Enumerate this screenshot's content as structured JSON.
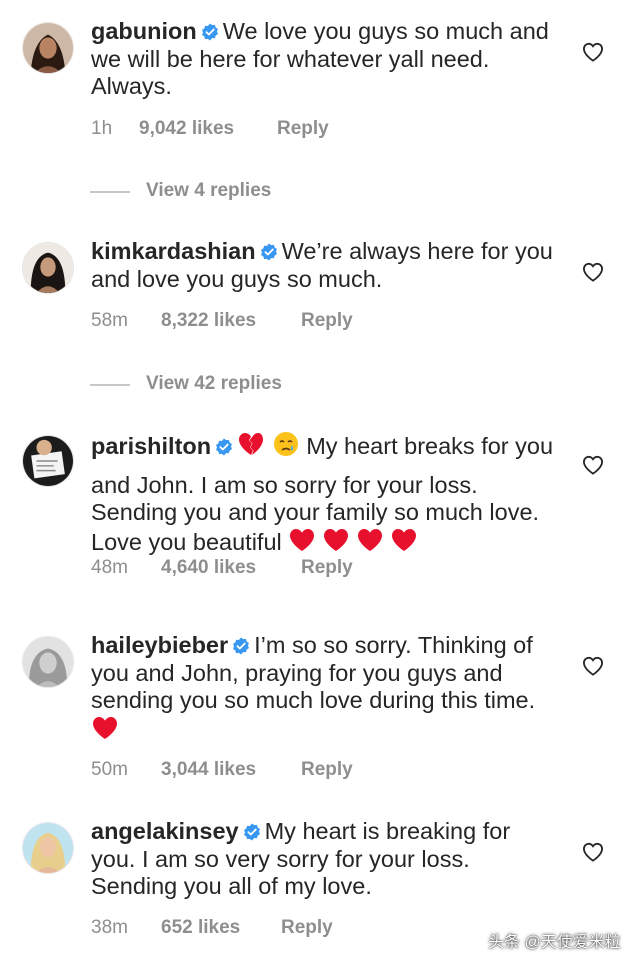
{
  "comments": [
    {
      "username": "gabunion",
      "text": "We love you guys so much and we will be here for whatever yall need. Always.",
      "time": "1h",
      "likes": "9,042 likes",
      "reply": "Reply",
      "view_replies": "View 4 replies"
    },
    {
      "username": "kimkardashian",
      "text": "We’re always here for you and love you guys so much.",
      "time": "58m",
      "likes": "8,322 likes",
      "reply": "Reply",
      "view_replies": "View 42 replies"
    },
    {
      "username": "parishilton",
      "text_after_emoji": "My heart breaks for you and John. I am so sorry for your loss. Sending you and your family so much love. Love you beautiful",
      "time": "48m",
      "likes": "4,640 likes",
      "reply": "Reply",
      "emojis_lead": [
        "broken-heart-emoji",
        "crying-face-emoji"
      ],
      "emojis_trail": [
        "red-heart-emoji",
        "red-heart-emoji",
        "red-heart-emoji",
        "red-heart-emoji"
      ]
    },
    {
      "username": "haileybieber",
      "text": "I’m so so sorry. Thinking of you and John, praying for you guys and sending you so much love during this time.",
      "time": "50m",
      "likes": "3,044 likes",
      "reply": "Reply",
      "emojis_trail": [
        "red-heart-emoji"
      ]
    },
    {
      "username": "angelakinsey",
      "text": "My heart is breaking for you. I am so very sorry for your loss. Sending you all of my love.",
      "time": "38m",
      "likes": "652 likes",
      "reply": "Reply"
    }
  ],
  "watermark": "头条 @天使爱米粒",
  "colors": {
    "text": "#262626",
    "meta": "#8e8e8e",
    "verified": "#3897f0",
    "heart_emoji": "#e8112d"
  }
}
